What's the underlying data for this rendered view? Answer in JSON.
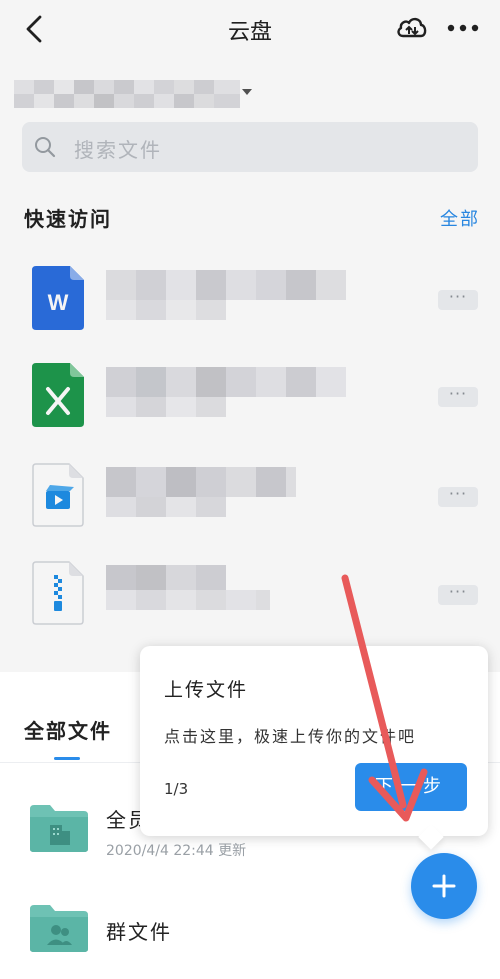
{
  "header": {
    "title": "云盘",
    "back_icon": "chevron-left-icon",
    "cloud_icon": "cloud-transfer-icon",
    "more_icon": "ellipsis-icon"
  },
  "search": {
    "placeholder": "搜索文件"
  },
  "quick_access": {
    "title": "快速访问",
    "all_label": "全部",
    "items": [
      {
        "icon": "word-doc-icon",
        "more": "···"
      },
      {
        "icon": "excel-sheet-icon",
        "more": "···"
      },
      {
        "icon": "video-file-icon",
        "more": "···"
      },
      {
        "icon": "zip-file-icon",
        "more": "···"
      }
    ]
  },
  "all_files": {
    "tab_label": "全部文件",
    "folders": [
      {
        "name": "全员",
        "meta": "2020/4/4 22:44 更新",
        "icon": "folder-building-icon"
      },
      {
        "name": "群文件",
        "meta": "",
        "icon": "folder-people-icon"
      }
    ]
  },
  "tooltip": {
    "title": "上传文件",
    "description": "点击这里，极速上传你的文件吧",
    "step": "1/3",
    "next_label": "下一步"
  },
  "fab": {
    "icon": "plus-icon"
  },
  "colors": {
    "accent": "#2a8cea",
    "annotation_arrow": "#e85a5a"
  }
}
